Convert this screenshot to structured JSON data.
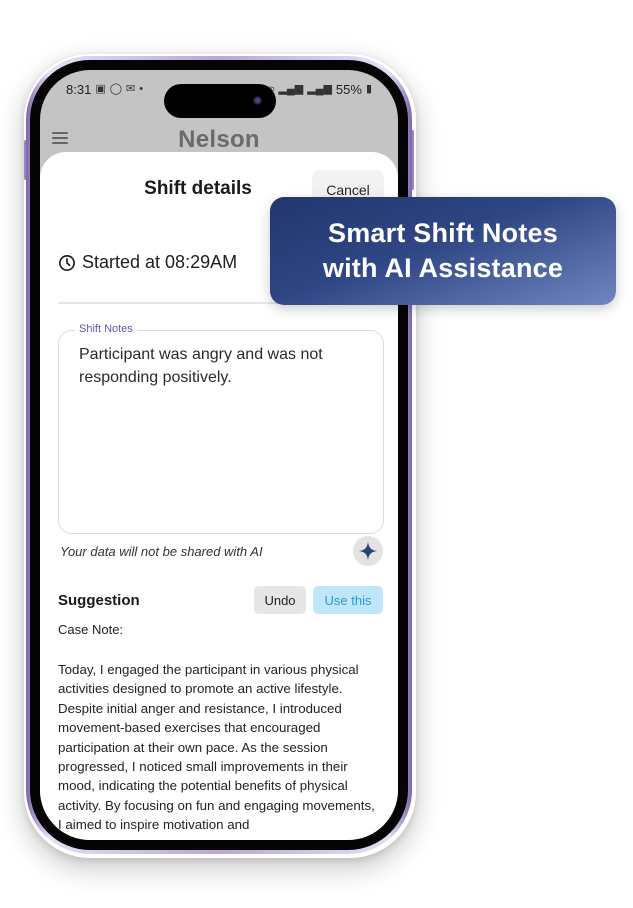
{
  "status_bar": {
    "time": "8:31",
    "left_icons": [
      "teams-icon",
      "whatsapp-icon",
      "outlook-icon",
      "dot-icon"
    ],
    "right_icons": [
      "wifi-icon",
      "volte-icon",
      "signal-icon",
      "signal-icon"
    ],
    "battery": "55%"
  },
  "header": {
    "title": "Nelson"
  },
  "sheet": {
    "title": "Shift details",
    "cancel_label": "Cancel",
    "started_text": "Started at 08:29AM",
    "notes": {
      "label": "Shift Notes",
      "value": "Participant was angry and was not responding positively."
    },
    "privacy_note": "Your data will not be shared with AI",
    "suggestion": {
      "title": "Suggestion",
      "undo_label": "Undo",
      "use_label": "Use this",
      "case_label": "Case Note:",
      "body": "Today, I engaged the participant in various physical activities designed to promote an active lifestyle. Despite initial anger and resistance, I introduced movement-based exercises that encouraged participation at their own pace. As the session progressed, I noticed small improvements in their mood, indicating the potential benefits of physical activity. By focusing on fun and engaging movements, I aimed to inspire motivation and"
    }
  },
  "promo": {
    "line1": "Smart Shift Notes",
    "line2": "with AI Assistance"
  },
  "colors": {
    "promo_start": "#22366c",
    "promo_end": "#6f86c2",
    "accent_purple": "#6b55a8",
    "use_this_bg": "#bfe6fb",
    "use_this_text": "#2a9ad6",
    "ai_star": "#2b3f7a"
  }
}
